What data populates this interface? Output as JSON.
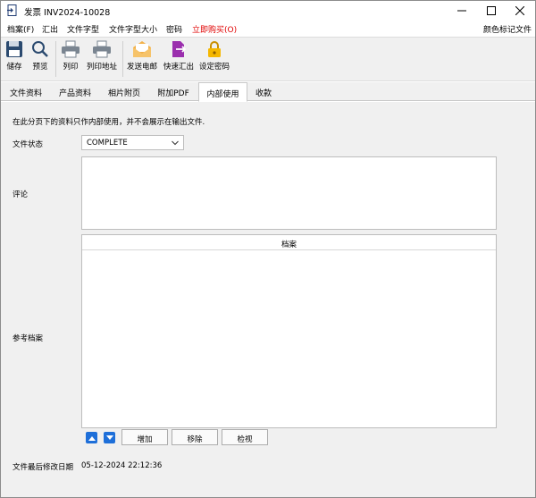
{
  "window": {
    "title": "发票 INV2024-10028",
    "minimize_icon": "minimize-icon",
    "maximize_icon": "maximize-icon",
    "close_icon": "close-icon"
  },
  "menu": {
    "items": [
      "档案(F)",
      "汇出",
      "文件字型",
      "文件字型大小",
      "密码",
      "立即购买(O)"
    ],
    "right_item": "颜色标记文件",
    "highlight_color": "#e00000"
  },
  "toolbar": {
    "items": [
      {
        "label": "储存",
        "icon": "save-icon"
      },
      {
        "label": "预览",
        "icon": "magnifier-icon"
      },
      {
        "label": "列印",
        "icon": "printer-icon"
      },
      {
        "label": "列印地址",
        "icon": "printer-address-icon"
      },
      {
        "label": "发送电邮",
        "icon": "envelope-icon"
      },
      {
        "label": "快速汇出",
        "icon": "quick-export-icon"
      },
      {
        "label": "设定密码",
        "icon": "lock-icon"
      }
    ]
  },
  "tabs": [
    "文件资料",
    "产品资料",
    "相片附页",
    "附加PDF",
    "内部使用",
    "收款"
  ],
  "active_tab": "内部使用",
  "internal": {
    "note": "在此分页下的资料只作内部使用，并不会展示在输出文件.",
    "status_label": "文件状态",
    "status_value": "COMPLETE",
    "comment_label": "评论",
    "comment_value": "",
    "reference_label": "参考档案",
    "files_column": "档案",
    "add_button": "增加",
    "remove_button": "移除",
    "view_button": "检视",
    "modified_label": "文件最后修改日期",
    "modified_value": "05-12-2024 22:12:36"
  },
  "colors": {
    "accent": "#1e6fd9",
    "toolbar_bg": "#f0f0f0",
    "purple_icon": "#9b2fae",
    "envelope": "#f2b14a",
    "lock": "#f5b700"
  }
}
